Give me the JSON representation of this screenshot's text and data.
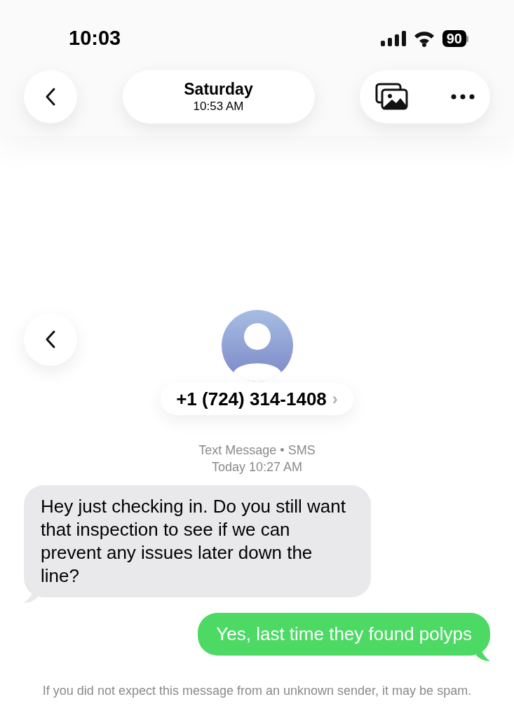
{
  "status_bar": {
    "time": "10:03",
    "battery": "90"
  },
  "header": {
    "day": "Saturday",
    "time": "10:53 AM"
  },
  "contact": {
    "phone": "+1 (724) 314-1408",
    "chevron": "›"
  },
  "thread_info": {
    "service": "Text Message • SMS",
    "time": "Today 10:27 AM"
  },
  "messages": [
    {
      "kind": "incoming",
      "text": "Hey just checking in. Do you still want that inspection to see if we can prevent any issues later down the line?"
    },
    {
      "kind": "outgoing",
      "text": "Yes, last time they found polyps"
    }
  ],
  "spam_notice": "If you did not expect this message from an unknown sender, it may be spam."
}
